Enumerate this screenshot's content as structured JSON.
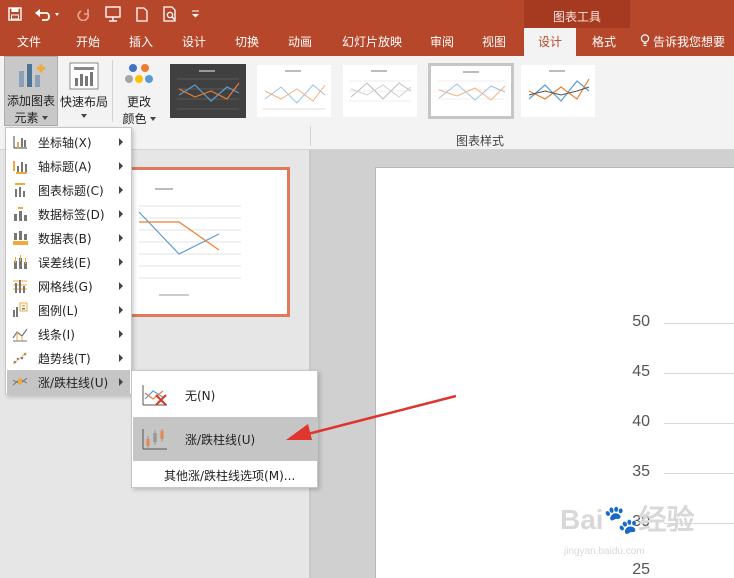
{
  "title_bar": {
    "context_group": "图表工具",
    "qat": [
      "save-icon",
      "undo-icon",
      "redo-icon",
      "start-from-beginning-icon",
      "new-file-icon",
      "print-preview-icon",
      "customize-qat-icon"
    ]
  },
  "tabs": [
    "文件",
    "开始",
    "插入",
    "设计",
    "切换",
    "动画",
    "幻灯片放映",
    "审阅",
    "视图",
    "设计",
    "格式"
  ],
  "active_tab_index": 9,
  "tell_me": "告诉我您想要",
  "ribbon": {
    "add_element_line1": "添加图表",
    "add_element_line2": "元素",
    "quick_layout": "快速布局",
    "change_colors_line1": "更改",
    "change_colors_line2": "颜色",
    "chart_styles_label": "图表样式"
  },
  "menu": {
    "items": [
      {
        "label": "坐标轴(X)",
        "icon": "axis-icon"
      },
      {
        "label": "轴标题(A)",
        "icon": "axis-title-icon"
      },
      {
        "label": "图表标题(C)",
        "icon": "chart-title-icon"
      },
      {
        "label": "数据标签(D)",
        "icon": "data-labels-icon"
      },
      {
        "label": "数据表(B)",
        "icon": "data-table-icon"
      },
      {
        "label": "误差线(E)",
        "icon": "error-bars-icon"
      },
      {
        "label": "网格线(G)",
        "icon": "gridlines-icon"
      },
      {
        "label": "图例(L)",
        "icon": "legend-icon"
      },
      {
        "label": "线条(I)",
        "icon": "lines-icon"
      },
      {
        "label": "趋势线(T)",
        "icon": "trendline-icon"
      },
      {
        "label": "涨/跌柱线(U)",
        "icon": "up-down-bars-icon"
      }
    ],
    "highlighted_index": 10
  },
  "submenu": {
    "items": [
      {
        "label": "无(N)",
        "icon": "no-up-down-bars-icon"
      },
      {
        "label": "涨/跌柱线(U)",
        "icon": "up-down-bars-option-icon"
      }
    ],
    "more_options": "其他涨/跌柱线选项(M)...",
    "highlighted_index": 1
  },
  "chart": {
    "y_ticks": [
      "50",
      "45",
      "40",
      "35",
      "30",
      "25"
    ]
  },
  "colors": {
    "accent": "#b7472a",
    "series_blue": "#5b9bd5",
    "series_orange": "#ed7d31",
    "arrow_red": "#e0342f"
  }
}
